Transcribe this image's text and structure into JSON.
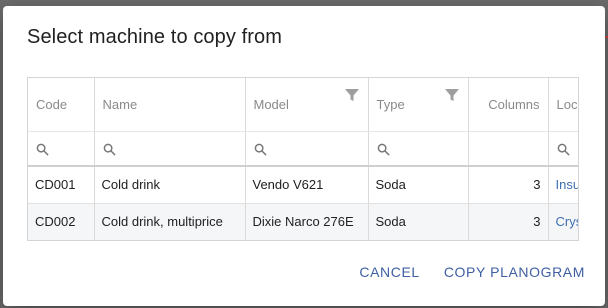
{
  "dialog": {
    "title": "Select machine to copy from"
  },
  "grid": {
    "columns": [
      {
        "label": "Code"
      },
      {
        "label": "Name"
      },
      {
        "label": "Model",
        "filter_icon": "filter-icon"
      },
      {
        "label": "Type",
        "filter_icon": "filter-icon"
      },
      {
        "label": "Columns"
      },
      {
        "label": "Loca"
      }
    ],
    "rows": [
      {
        "code": "CD001",
        "name": "Cold drink",
        "model": "Vendo V621",
        "type": "Soda",
        "columns": "3",
        "location": "Insu"
      },
      {
        "code": "CD002",
        "name": "Cold drink, multiprice",
        "model": "Dixie Narco 276E",
        "type": "Soda",
        "columns": "3",
        "location": "Crys"
      }
    ]
  },
  "actions": {
    "cancel": "CANCEL",
    "copy": "COPY PLANOGRAM"
  },
  "colors": {
    "accent": "#3e5fa3",
    "link": "#3f6fb5"
  }
}
